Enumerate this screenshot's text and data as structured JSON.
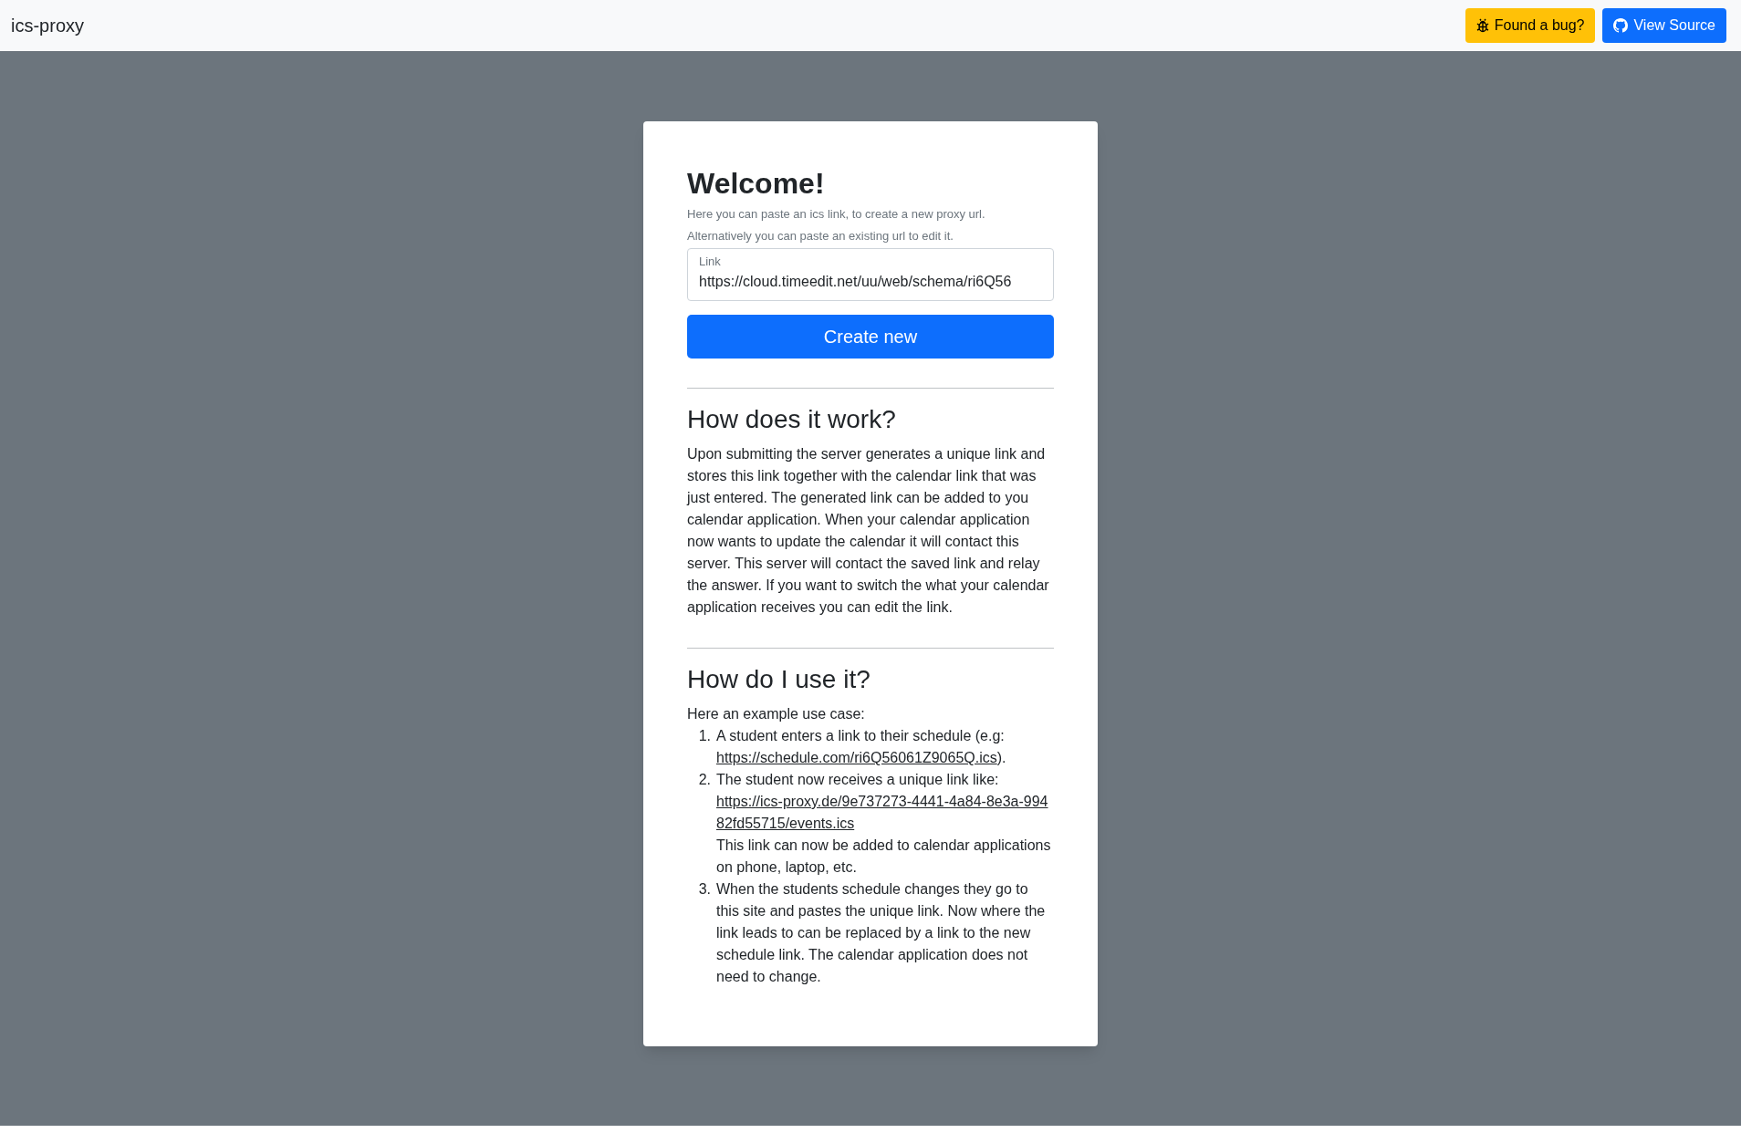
{
  "navbar": {
    "brand": "ics-proxy",
    "buttons": [
      {
        "label": "Found a bug?",
        "kind": "warning"
      },
      {
        "label": "View Source",
        "kind": "primary"
      }
    ]
  },
  "card": {
    "title": "Welcome!",
    "intro": [
      "Here you can paste an ics link, to create a new proxy url.",
      "Alternatively you can paste an existing url to edit it."
    ],
    "field": {
      "label": "Link",
      "value": "https://cloud.timeedit.net/uu/web/schema/ri6Q56"
    },
    "button": "Create new",
    "sections": [
      {
        "heading": "How does it work?",
        "paragraphs": [
          "Upon submitting the server generates a unique link and stores this link together with the calendar link that was just entered. The generated link can be added to you calendar application. When your calendar application now wants to update the calendar it will contact this server. This server will contact the saved link and relay the answer. If you want to switch the what your calendar application receives you can edit the link."
        ]
      },
      {
        "heading": "How do I use it?",
        "paragraphs": [
          "Here an example use case:"
        ],
        "steps": [
          {
            "number": "1.",
            "segments": [
              {
                "kind": "text",
                "text": "A student enters a link to their schedule (e.g: "
              },
              {
                "kind": "link",
                "text": "https://schedule.com/ri6Q56061Z9065Q.ics"
              },
              {
                "kind": "text",
                "text": ")."
              }
            ]
          },
          {
            "number": "2.",
            "segments": [
              {
                "kind": "block-text",
                "text": "The student now receives a unique link like:"
              },
              {
                "kind": "block-link",
                "text": "https://ics-proxy.de/9e737273-4441-4a84-8e3a-99482fd55715/events.ics"
              },
              {
                "kind": "block-text",
                "text": "This link can now be added to calendar applications on phone, laptop, etc."
              }
            ]
          },
          {
            "number": "3.",
            "segments": [
              {
                "kind": "block-text",
                "text": "When the students schedule changes they go to this site and pastes the unique link. Now where the link leads to can be replaced by a link to the new schedule link. The calendar application does not need to change."
              }
            ]
          }
        ]
      }
    ]
  }
}
